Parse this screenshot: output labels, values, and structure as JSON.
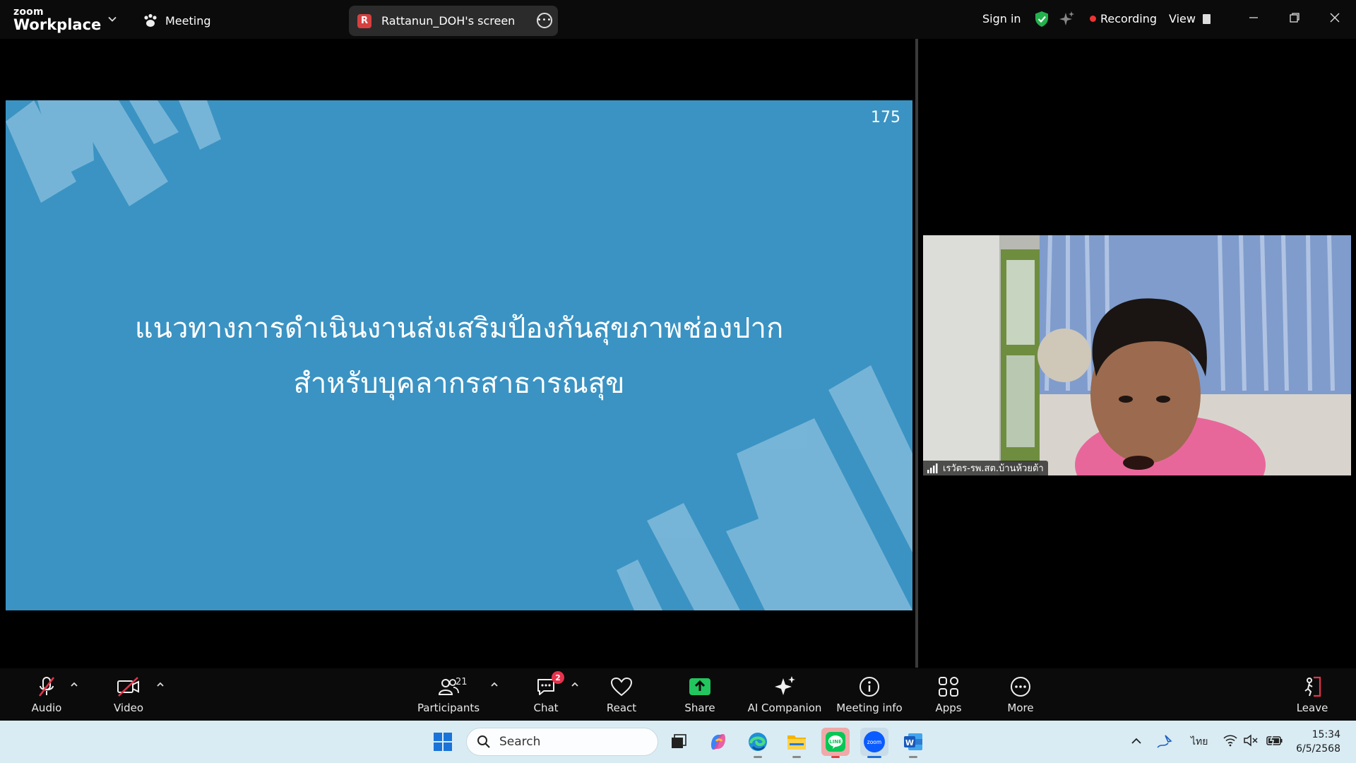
{
  "app": {
    "logo_small": "zoom",
    "logo_big": "Workplace",
    "meeting_label": "Meeting",
    "shared_screen_initial": "R",
    "shared_screen_label": "Rattanun_DOH's screen",
    "signin_label": "Sign in",
    "recording_label": "Recording",
    "view_label": "View",
    "colors": {
      "recording": "#e33333",
      "shield": "#22b14c",
      "slide_bg": "#3a93c3"
    }
  },
  "slide": {
    "page_number": "175",
    "title_line1": "แนวทางการดำเนินงานส่งเสริมป้องกันสุขภาพช่องปาก",
    "title_line2": "สำหรับบุคลากรสาธารณสุข"
  },
  "video": {
    "participant_name": "เรวัตร-รพ.สต.บ้านห้วยต้า"
  },
  "toolbar": {
    "audio": "Audio",
    "video": "Video",
    "participants": "Participants",
    "participants_count": "21",
    "chat": "Chat",
    "chat_badge": "2",
    "react": "React",
    "share": "Share",
    "ai_companion": "AI Companion",
    "meeting_info": "Meeting info",
    "apps": "Apps",
    "more": "More",
    "leave": "Leave"
  },
  "taskbar": {
    "search_placeholder": "Search",
    "language": "ไทย",
    "time": "15:34",
    "date": "6/5/2568"
  }
}
